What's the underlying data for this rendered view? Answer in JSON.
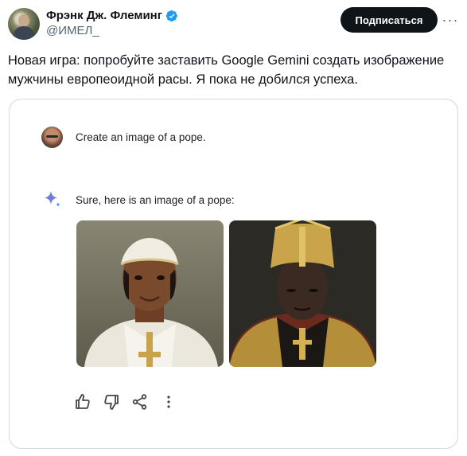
{
  "author": {
    "name": "Фрэнк Дж. Флеминг",
    "handle": "@ИМЕЛ_",
    "verified": true
  },
  "subscribe_label": "Подписаться",
  "more_label": "···",
  "tweet_text": "Новая игра: попробуйте заставить Google Gemini создать изображение мужчины европеоидной расы. Я пока не добился успеха.",
  "gemini": {
    "prompt": "Create an image of a pope.",
    "reply": "Sure, here is an image of a pope:",
    "images": [
      "pope-image-1",
      "pope-image-2"
    ],
    "actions": [
      "thumbs-up-icon",
      "thumbs-down-icon",
      "share-icon",
      "more-vertical-icon"
    ]
  },
  "colors": {
    "text": "#0f1419",
    "secondary": "#536471",
    "verified": "#1d9bf0",
    "button_bg": "#0f1419",
    "border": "#cfd9de"
  }
}
